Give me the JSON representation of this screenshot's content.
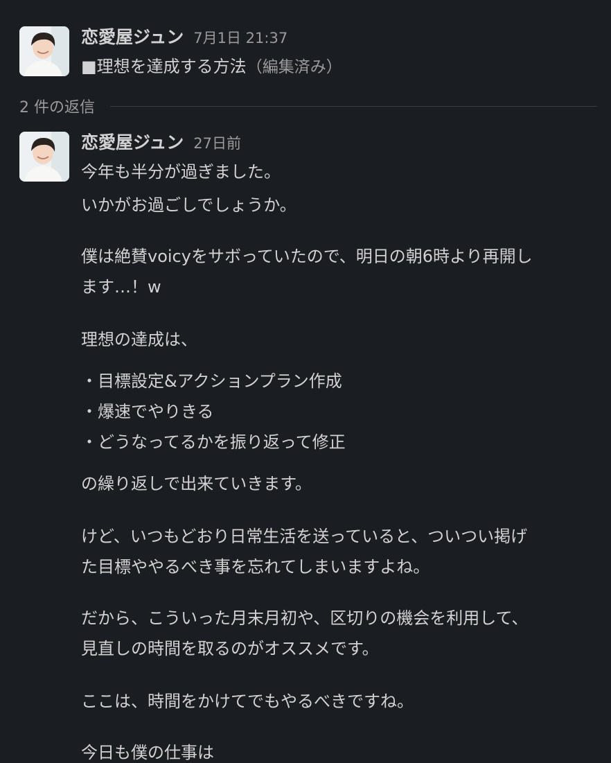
{
  "parent_message": {
    "username": "恋愛屋ジュン",
    "timestamp": "7月1日 21:37",
    "text": "■理想を達成する方法",
    "edited_label": "（編集済み）"
  },
  "thread": {
    "reply_count_label": "2 件の返信"
  },
  "reply_message": {
    "username": "恋愛屋ジュン",
    "timestamp": "27日前",
    "lines": [
      "今年も半分が過ぎました。",
      "いかがお過ごしでしょうか。",
      "僕は絶賛voicyをサボっていたので、明日の朝6時より再開し",
      "ます…！w",
      "理想の達成は、",
      "・目標設定&アクションプラン作成",
      "・爆速でやりきる",
      "・どうなってるかを振り返って修正",
      "の繰り返しで出来ていきます。",
      "けど、いつもどおり日常生活を送っていると、ついつい掲げ",
      "た目標ややるべき事を忘れてしまいますよね。",
      "だから、こういった月末月初や、区切りの機会を利用して、",
      "見直しの時間を取るのがオススメです。",
      "ここは、時間をかけてでもやるべきですね。",
      "今日も僕の仕事は"
    ]
  },
  "colors": {
    "background": "#1a1d21",
    "text_primary": "#d1d2d3",
    "text_secondary": "#9a9b9e",
    "divider": "#3b3d41"
  }
}
